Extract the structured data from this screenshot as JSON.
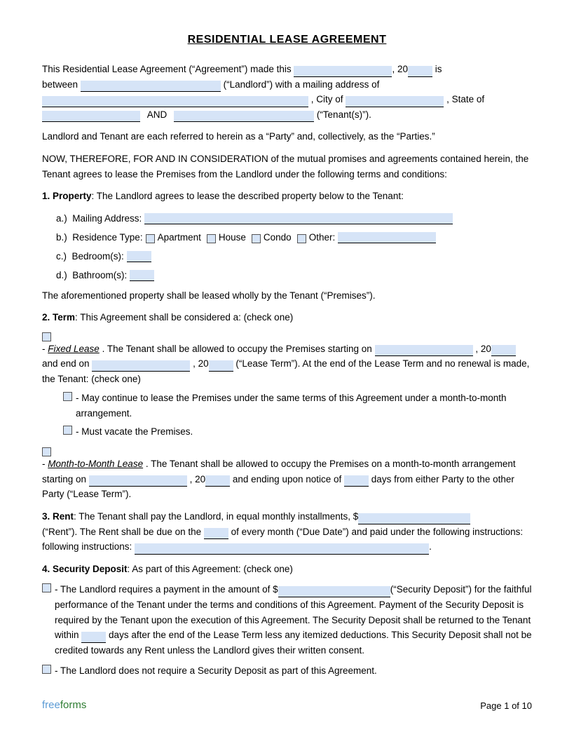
{
  "title": "RESIDENTIAL LEASE AGREEMENT",
  "intro": {
    "line1_pre": "This Residential Lease Agreement (“Agreement”) made this",
    "line1_year": "20",
    "line1_post": "is",
    "line2_pre": "between",
    "line2_mid": "(“Landlord”) with a mailing address of",
    "line3_city_pre": ", City of",
    "line3_state_post": ", State of",
    "line4_and": "AND",
    "line4_post": "(“Tenant(s)”)."
  },
  "parties_text": "Landlord and Tenant are each referred to herein as a “Party” and, collectively, as the “Parties.”",
  "consideration_text": "NOW, THEREFORE, FOR AND IN CONSIDERATION of the mutual promises and agreements contained herein, the Tenant agrees to lease the Premises from the Landlord under the following terms and conditions:",
  "section1": {
    "heading": "1. Property",
    "intro": ": The Landlord agrees to lease the described property below to the Tenant:",
    "rows": [
      {
        "label": "a.)  Mailing Address:"
      },
      {
        "label": "b.)  Residence Type:",
        "options": [
          "Apartment",
          "House",
          "Condo",
          "Other:"
        ]
      },
      {
        "label": "c.)  Bedroom(s):"
      },
      {
        "label": "d.)  Bathroom(s):"
      }
    ],
    "closing": "The aforementioned property shall be leased wholly by the Tenant (“Premises”)."
  },
  "section2": {
    "heading": "2. Term",
    "intro": ": This Agreement shall be considered a: (check one)",
    "fixed_lease": {
      "label": "Fixed Lease",
      "text1": ". The Tenant shall be allowed to occupy the Premises starting on",
      "text2": ", 20",
      "text3": "and end on",
      "text4": ", 20",
      "text5": "(“Lease Term”). At the end of the Lease Term and no renewal is made, the Tenant: (check one)",
      "sub1": "- May continue to lease the Premises under the same terms of this Agreement under a month-to-month arrangement.",
      "sub2": "- Must vacate the Premises."
    },
    "month_lease": {
      "label": "Month-to-Month Lease",
      "text1": ". The Tenant shall be allowed to occupy the Premises on a month-to-month arrangement starting on",
      "text2": ", 20",
      "text3": "and ending upon notice of",
      "text4": "days from either Party to the other Party (“Lease Term”)."
    }
  },
  "section3": {
    "heading": "3. Rent",
    "text1": ": The Tenant shall pay the Landlord, in equal monthly installments, $",
    "text2": "(“Rent”). The Rent shall be due on the",
    "text3": "of every month (“Due Date”) and paid under the following instructions:",
    "text4": "."
  },
  "section4": {
    "heading": "4. Security Deposit",
    "intro": ": As part of this Agreement: (check one)",
    "option1_pre": "- The Landlord requires a payment in the amount of $",
    "option1_post": "(“Security Deposit”) for the faithful performance of the Tenant under the terms and conditions of this Agreement. Payment of the Security Deposit is required by the Tenant upon the execution of this Agreement. The Security Deposit shall be returned to the Tenant within",
    "option1_days": "days after the end of the Lease Term less any itemized deductions. This Security Deposit shall not be credited towards any Rent unless the Landlord gives their written consent.",
    "option2": "- The Landlord does not require a Security Deposit as part of this Agreement."
  },
  "footer": {
    "brand_free": "free",
    "brand_forms": "forms",
    "page_label": "Page 1 of 10"
  }
}
